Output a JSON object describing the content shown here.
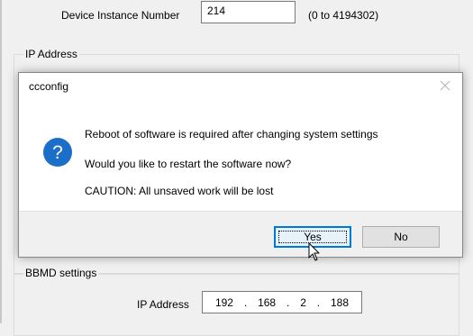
{
  "settings": {
    "device_instance_label": "Device Instance Number",
    "device_instance_value": "214",
    "device_instance_range": "(0 to 4194302)",
    "ip_group_label": "IP Address",
    "bbmd_group_label": "BBMD settings",
    "bbmd_ip_label": "IP Address",
    "bbmd_ip_octets": [
      "192",
      "168",
      "2",
      "188"
    ]
  },
  "dialog": {
    "title": "ccconfig",
    "icon": "question-icon",
    "lines": [
      "Reboot of software is required after changing system settings",
      "Would you like to restart the software now?",
      "CAUTION: All unsaved work will be lost"
    ],
    "yes_label": "Yes",
    "no_label": "No",
    "focused_button": "yes"
  },
  "colors": {
    "window_bg": "#f0f0f0",
    "dialog_bg": "#ffffff",
    "icon_blue": "#1c6fc9",
    "focus_blue": "#0078d7"
  }
}
